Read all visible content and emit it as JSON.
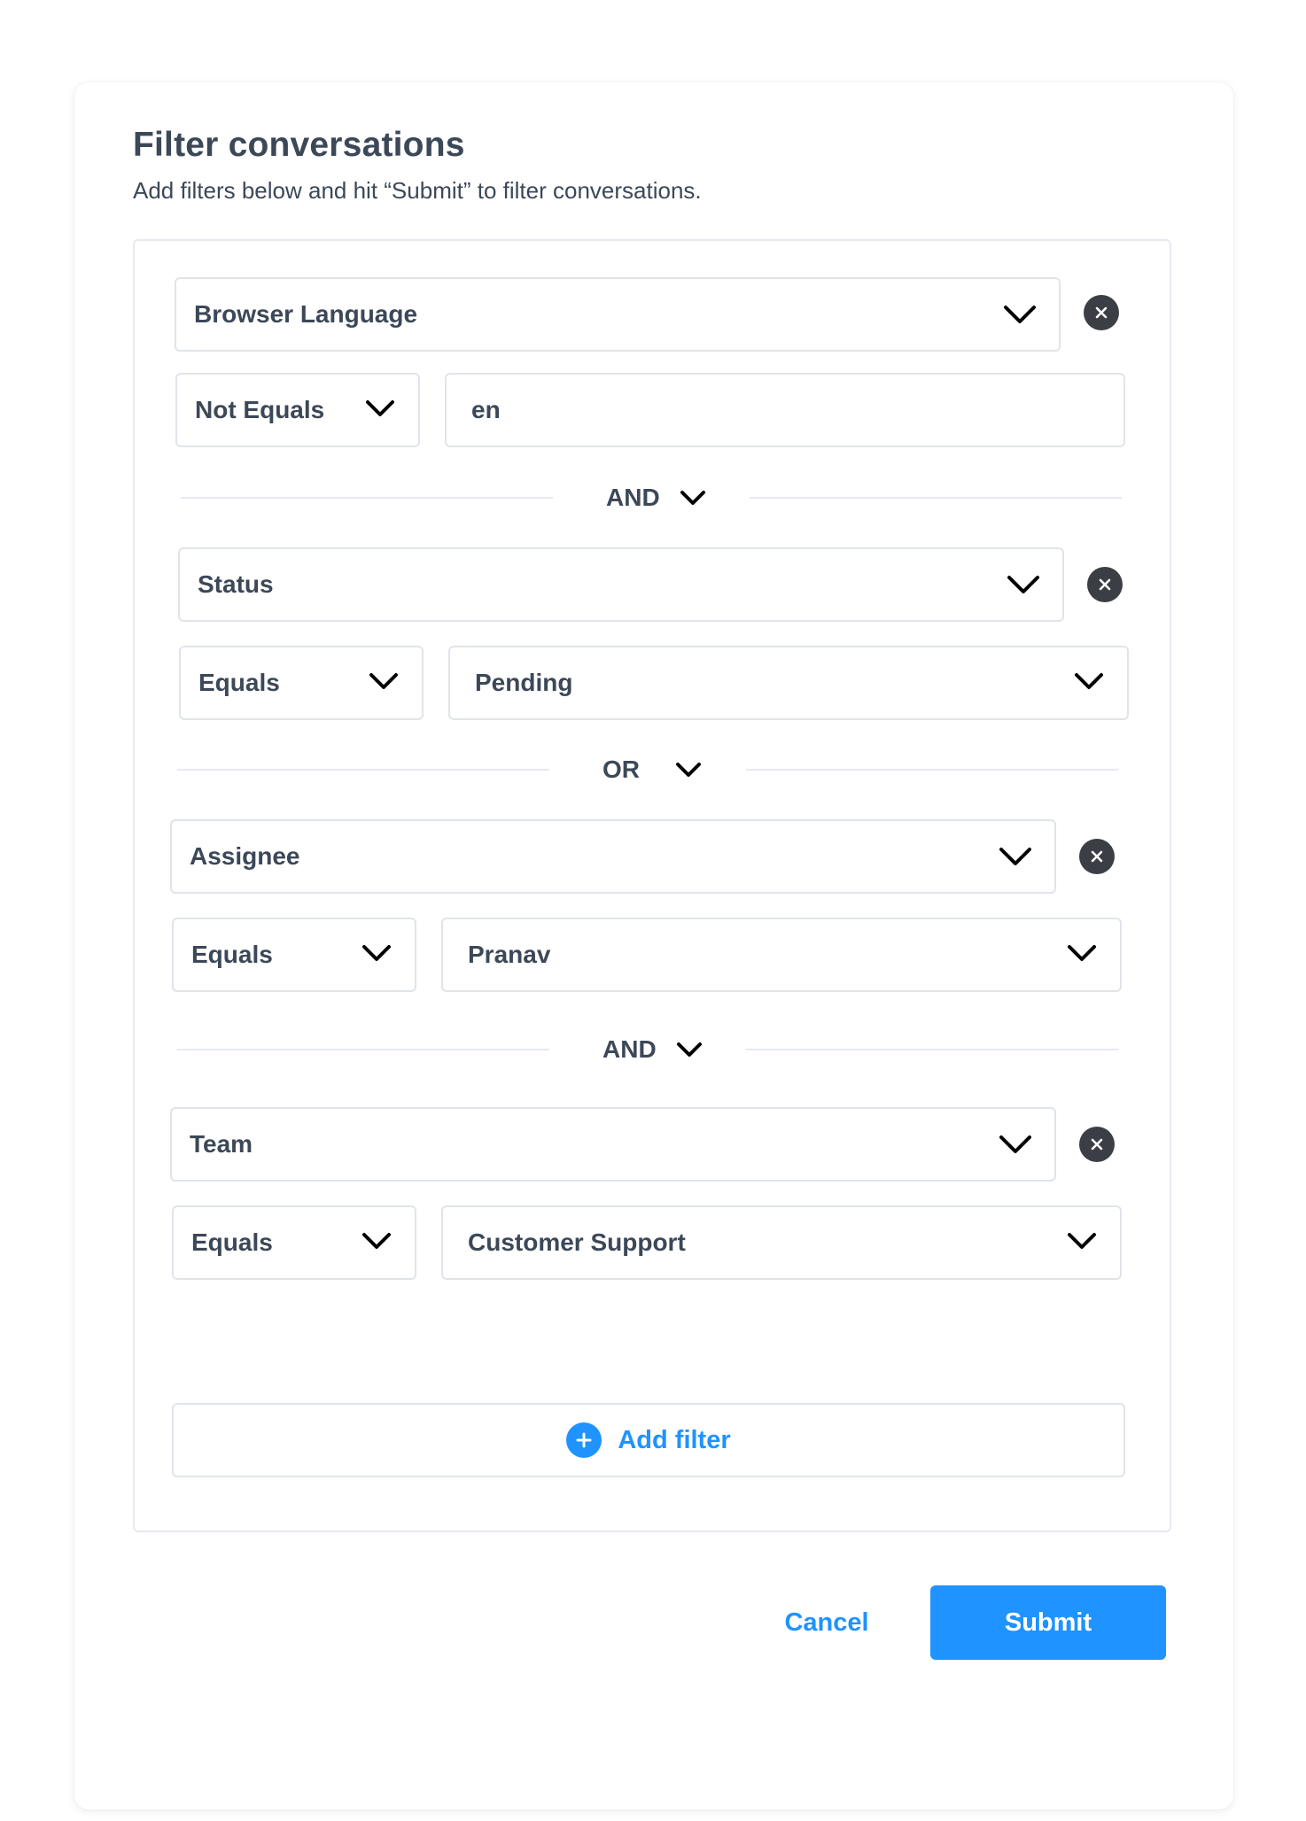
{
  "dialog": {
    "title": "Filter conversations",
    "subtitle": "Add filters below and hit “Submit” to filter conversations."
  },
  "filters": [
    {
      "attribute": "Browser Language",
      "operator": "Not Equals",
      "value": "en",
      "value_type": "text"
    },
    {
      "attribute": "Status",
      "operator": "Equals",
      "value": "Pending",
      "value_type": "select"
    },
    {
      "attribute": "Assignee",
      "operator": "Equals",
      "value": "Pranav",
      "value_type": "select"
    },
    {
      "attribute": "Team",
      "operator": "Equals",
      "value": "Customer Support",
      "value_type": "select"
    }
  ],
  "operators": [
    "AND",
    "OR",
    "AND"
  ],
  "actions": {
    "add_filter": "Add filter",
    "cancel": "Cancel",
    "submit": "Submit"
  },
  "colors": {
    "accent": "#1f93ff",
    "text": "#3c4858",
    "border": "#e0e4ea",
    "remove_icon_bg": "#3b3f45"
  },
  "icons": {
    "dropdown": "chevron-down-icon",
    "remove": "close-circle-icon",
    "add": "plus-circle-icon"
  }
}
